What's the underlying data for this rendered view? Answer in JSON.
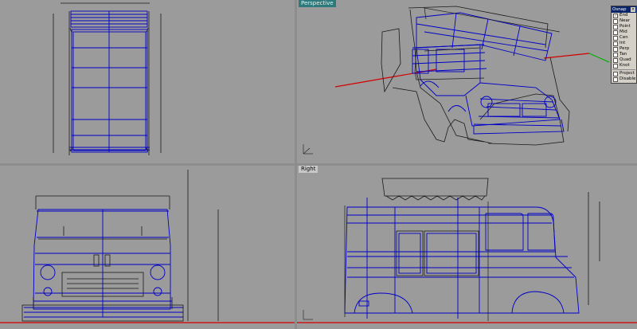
{
  "viewports": {
    "top": {
      "title": ""
    },
    "perspective": {
      "title": "Perspective"
    },
    "front": {
      "title": ""
    },
    "right": {
      "title": "Right"
    }
  },
  "osnap": {
    "title": "Osnap",
    "close_label": "×",
    "items": [
      {
        "label": "End",
        "checked": true
      },
      {
        "label": "Near",
        "checked": false
      },
      {
        "label": "Point",
        "checked": false
      },
      {
        "label": "Mid",
        "checked": false
      },
      {
        "label": "Cen",
        "checked": false
      },
      {
        "label": "Int",
        "checked": false
      },
      {
        "label": "Perp",
        "checked": false
      },
      {
        "label": "Tan",
        "checked": false
      },
      {
        "label": "Quad",
        "checked": false
      },
      {
        "label": "Knot",
        "checked": false
      }
    ],
    "extras": [
      {
        "label": "Project",
        "checked": false
      },
      {
        "label": "Disable",
        "checked": false
      }
    ]
  },
  "colors": {
    "viewport_bg": "#9b9b9b",
    "model_blue": "#0000c8",
    "line_black": "#1a1a1a",
    "axis_red": "#d40000",
    "axis_green": "#00b000",
    "active_title": "#2c7a7c"
  }
}
